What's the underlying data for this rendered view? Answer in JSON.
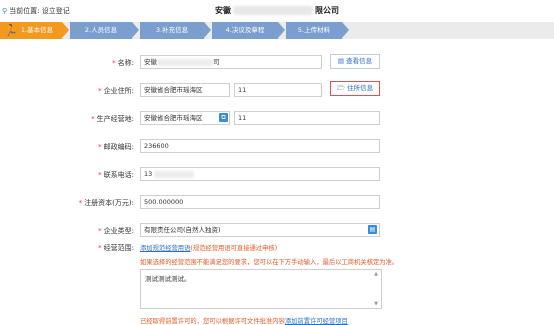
{
  "header": {
    "location_label": "当前位置:",
    "location_value": "设立登记",
    "company_prefix": "安徽",
    "company_suffix": "限公司"
  },
  "steps": [
    {
      "label": "1.基本信息",
      "state": "active"
    },
    {
      "label": "2.人员信息",
      "state": "inactive"
    },
    {
      "label": "3.补充信息",
      "state": "inactive"
    },
    {
      "label": "4.决议及章程",
      "state": "inactive"
    },
    {
      "label": "5.上传材料",
      "state": "inactive"
    }
  ],
  "form": {
    "name": {
      "label": "名称:",
      "value_prefix": "安徽",
      "value_suffix": "司",
      "button": "查看信息"
    },
    "residence": {
      "label": "企业住所:",
      "value": "安徽省合肥市瑶海区",
      "extra": "11",
      "button": "住所信息"
    },
    "business_place": {
      "label": "生产经营地:",
      "value": "安徽省合肥市瑶海区",
      "extra": "11"
    },
    "postal_code": {
      "label": "邮政编码:",
      "value": "236600"
    },
    "phone": {
      "label": "联系电话:",
      "value": "13"
    },
    "capital": {
      "label": "注册资本(万元):",
      "value": "500.000000"
    },
    "company_type": {
      "label": "企业类型:",
      "value": "有限责任公司(自然人独资)"
    },
    "business_scope": {
      "label": "经营范围:",
      "link": "添加规范经营用语",
      "hint": "(规范经营用语可直接通过申核)",
      "warning": "如果选择的经营范围不能满足您的要求，您可以在下方手动输入，最后以工商机关核定为准。",
      "text": "测试测试测试。",
      "bottom_text": "已经取得前置许可的，您可以根据许可文件批准内容",
      "bottom_link": "添加前置许可经营项目"
    }
  },
  "colors": {
    "accent": "#f19a1f",
    "step_inactive": "#7a9fcf",
    "link": "#2a6fc4",
    "required": "#e33333",
    "warning": "#e05a2a"
  }
}
